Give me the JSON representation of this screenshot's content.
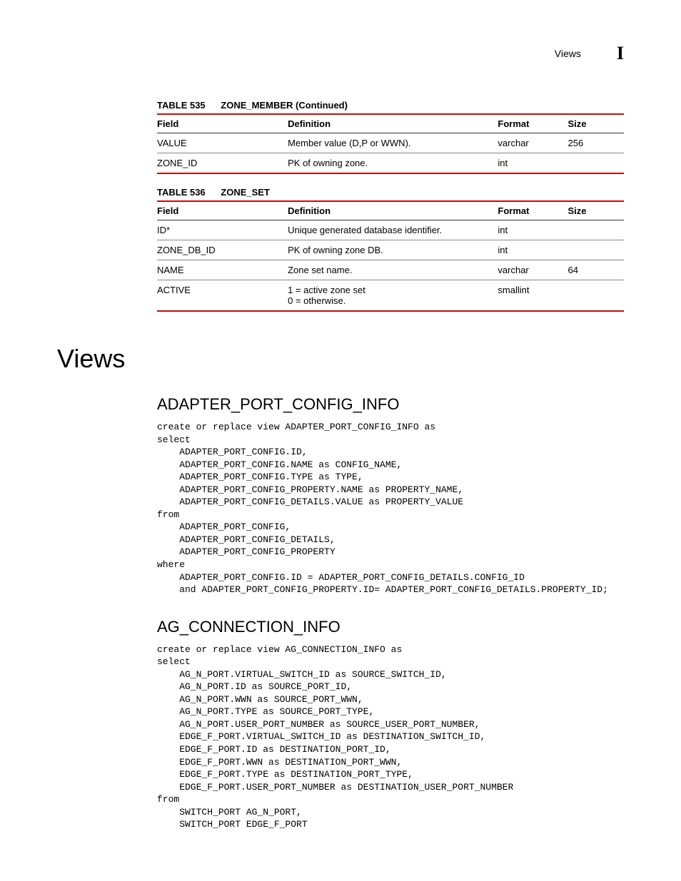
{
  "header": {
    "running_title": "Views",
    "chapter_letter": "I"
  },
  "table535": {
    "caption_label": "TABLE 535",
    "caption_title": "ZONE_MEMBER (Continued)",
    "head": {
      "field": "Field",
      "definition": "Definition",
      "format": "Format",
      "size": "Size"
    },
    "rows": [
      {
        "field": "VALUE",
        "definition": "Member value (D,P or WWN).",
        "format": "varchar",
        "size": "256"
      },
      {
        "field": "ZONE_ID",
        "definition": "PK of owning zone.",
        "format": "int",
        "size": ""
      }
    ]
  },
  "table536": {
    "caption_label": "TABLE 536",
    "caption_title": "ZONE_SET",
    "head": {
      "field": "Field",
      "definition": "Definition",
      "format": "Format",
      "size": "Size"
    },
    "rows": [
      {
        "field": "ID*",
        "definition": "Unique generated database identifier.",
        "format": "int",
        "size": ""
      },
      {
        "field": "ZONE_DB_ID",
        "definition": "PK of owning zone DB.",
        "format": "int",
        "size": ""
      },
      {
        "field": "NAME",
        "definition": "Zone set name.",
        "format": "varchar",
        "size": "64"
      },
      {
        "field": "ACTIVE",
        "definition": "1 = active zone set\n0 = otherwise.",
        "format": "smallint",
        "size": ""
      }
    ]
  },
  "section": {
    "heading": "Views",
    "view1": {
      "name": "ADAPTER_PORT_CONFIG_INFO",
      "sql": "create or replace view ADAPTER_PORT_CONFIG_INFO as\nselect\n    ADAPTER_PORT_CONFIG.ID,\n    ADAPTER_PORT_CONFIG.NAME as CONFIG_NAME,\n    ADAPTER_PORT_CONFIG.TYPE as TYPE,\n    ADAPTER_PORT_CONFIG_PROPERTY.NAME as PROPERTY_NAME,\n    ADAPTER_PORT_CONFIG_DETAILS.VALUE as PROPERTY_VALUE\nfrom\n    ADAPTER_PORT_CONFIG,\n    ADAPTER_PORT_CONFIG_DETAILS,\n    ADAPTER_PORT_CONFIG_PROPERTY\nwhere\n    ADAPTER_PORT_CONFIG.ID = ADAPTER_PORT_CONFIG_DETAILS.CONFIG_ID\n    and ADAPTER_PORT_CONFIG_PROPERTY.ID= ADAPTER_PORT_CONFIG_DETAILS.PROPERTY_ID;"
    },
    "view2": {
      "name": "AG_CONNECTION_INFO",
      "sql": "create or replace view AG_CONNECTION_INFO as\nselect\n    AG_N_PORT.VIRTUAL_SWITCH_ID as SOURCE_SWITCH_ID,\n    AG_N_PORT.ID as SOURCE_PORT_ID,\n    AG_N_PORT.WWN as SOURCE_PORT_WWN,\n    AG_N_PORT.TYPE as SOURCE_PORT_TYPE,\n    AG_N_PORT.USER_PORT_NUMBER as SOURCE_USER_PORT_NUMBER,\n    EDGE_F_PORT.VIRTUAL_SWITCH_ID as DESTINATION_SWITCH_ID,\n    EDGE_F_PORT.ID as DESTINATION_PORT_ID,\n    EDGE_F_PORT.WWN as DESTINATION_PORT_WWN,\n    EDGE_F_PORT.TYPE as DESTINATION_PORT_TYPE,\n    EDGE_F_PORT.USER_PORT_NUMBER as DESTINATION_USER_PORT_NUMBER\nfrom\n    SWITCH_PORT AG_N_PORT,\n    SWITCH_PORT EDGE_F_PORT"
    }
  }
}
